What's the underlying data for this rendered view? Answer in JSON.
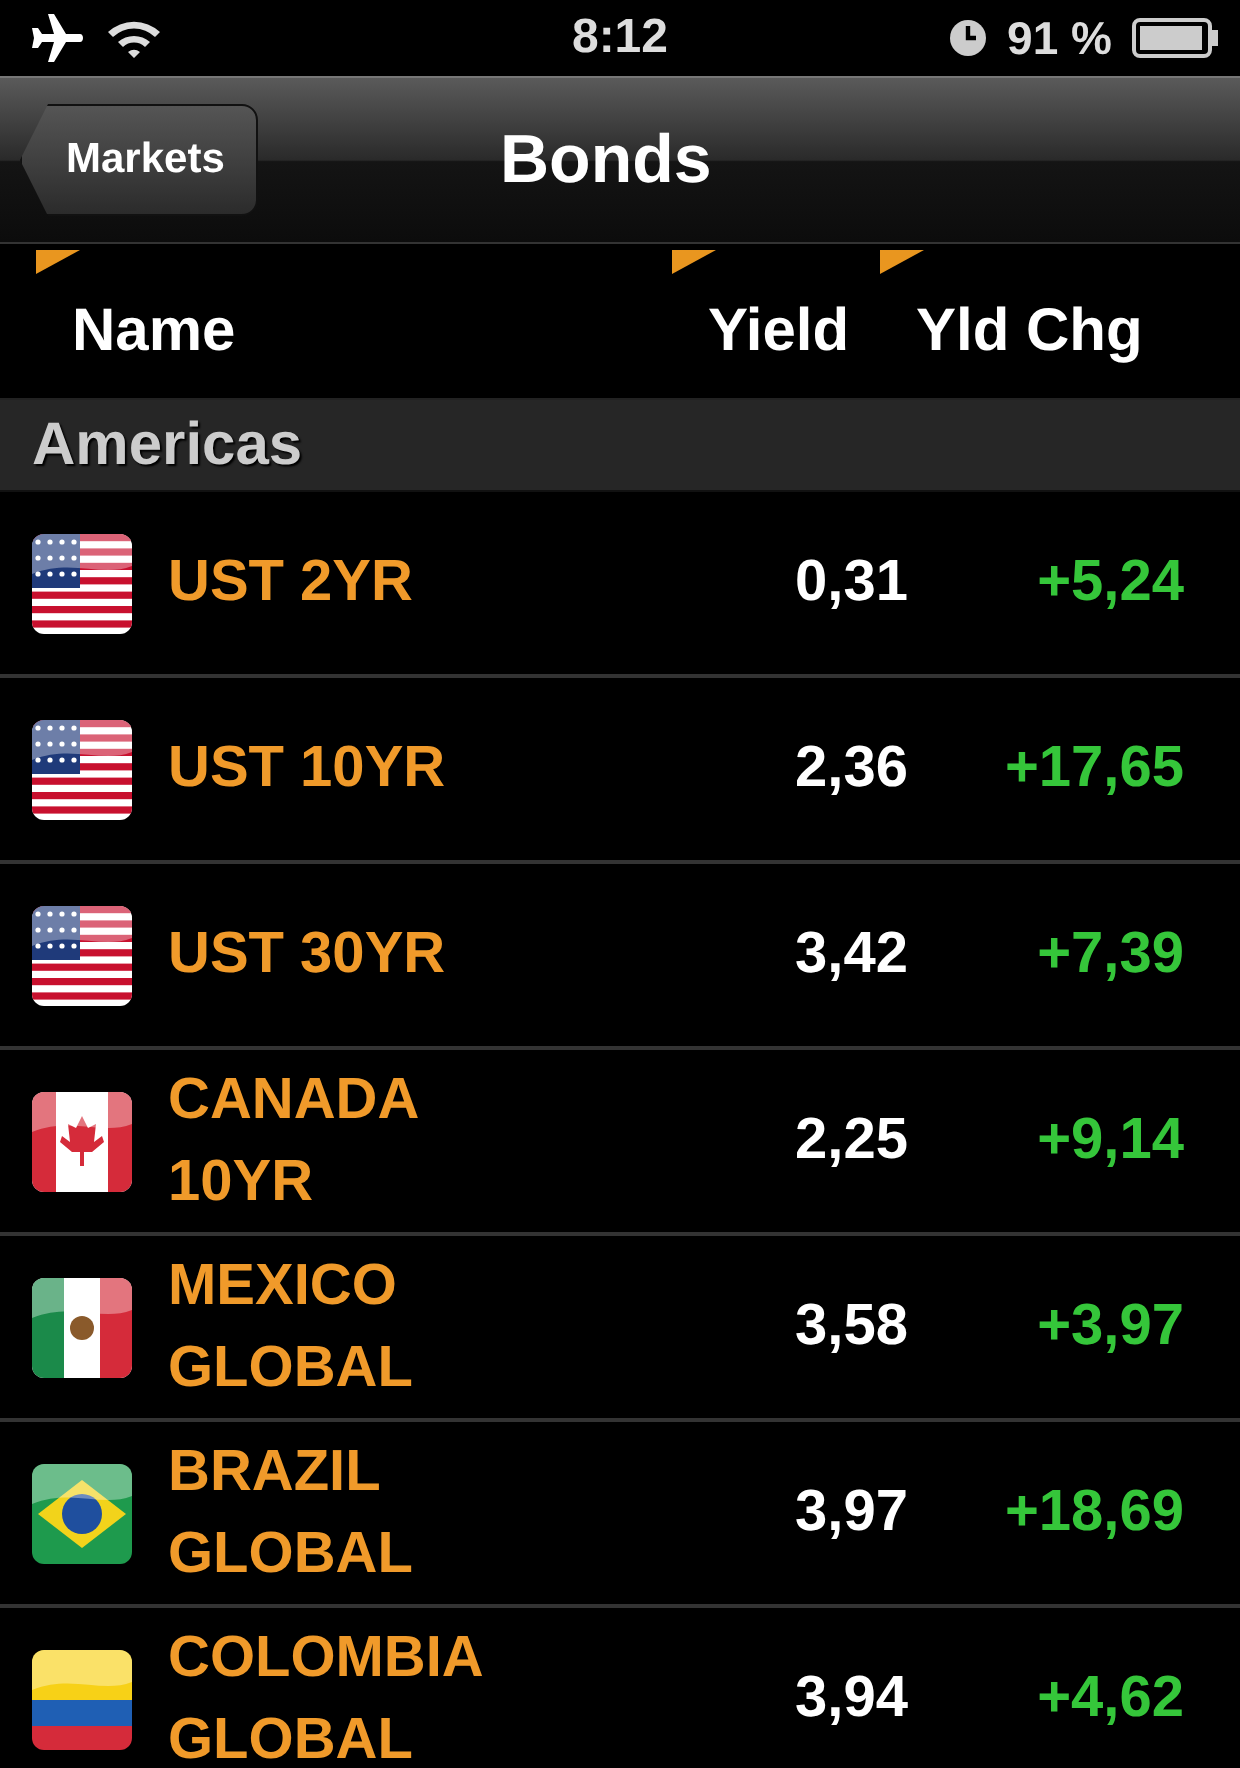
{
  "status_bar": {
    "time": "8:12",
    "battery": "91 %"
  },
  "nav_bar": {
    "back": "Markets",
    "title": "Bonds"
  },
  "columns": [
    "Name",
    "Yield",
    "Yld Chg"
  ],
  "section": "Americas",
  "rows": [
    {
      "kind": "us",
      "name": "UST 2YR",
      "yield": "0,31",
      "change": "+5,24"
    },
    {
      "kind": "us",
      "name": "UST 10YR",
      "yield": "2,36",
      "change": "+17,65"
    },
    {
      "kind": "us",
      "name": "UST 30YR",
      "yield": "3,42",
      "change": "+7,39"
    },
    {
      "kind": "ca",
      "name": "CANADA\n10YR",
      "yield": "2,25",
      "change": "+9,14"
    },
    {
      "kind": "mx",
      "name": "MEXICO\nGLOBAL",
      "yield": "3,58",
      "change": "+3,97"
    },
    {
      "kind": "br",
      "name": "BRAZIL\nGLOBAL",
      "yield": "3,97",
      "change": "+18,69"
    },
    {
      "kind": "co",
      "name": "COLOMBIA\nGLOBAL",
      "yield": "3,94",
      "change": "+4,62"
    }
  ]
}
